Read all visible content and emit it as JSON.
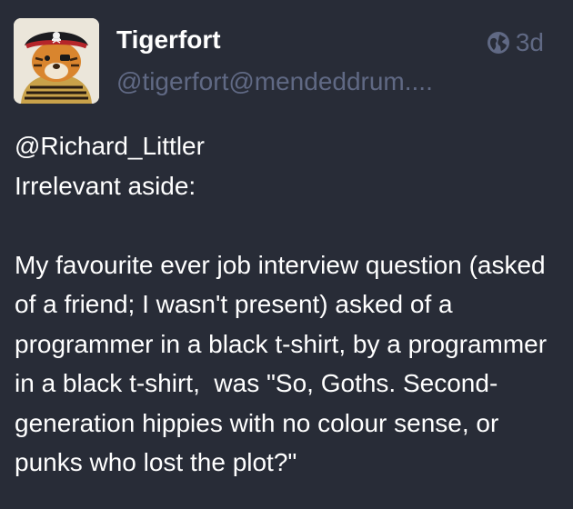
{
  "status": {
    "author": {
      "display_name": "Tigerfort",
      "handle": "@tigerfort@mendeddrum...."
    },
    "visibility_icon": "globe-icon",
    "relative_time": "3d",
    "content": {
      "mention": "@Richard_Littler",
      "line1": "Irrelevant aside:",
      "paragraph2": "My favourite ever job interview question (asked of a friend; I wasn't present) asked of a programmer in a black t-shirt, by a programmer in a black t-shirt,  was \"So, Goths. Second-generation hippies with no colour sense, or punks who lost the plot?\""
    }
  },
  "colors": {
    "background": "#282c37",
    "primary_text": "#ffffff",
    "secondary_text": "#606984"
  }
}
